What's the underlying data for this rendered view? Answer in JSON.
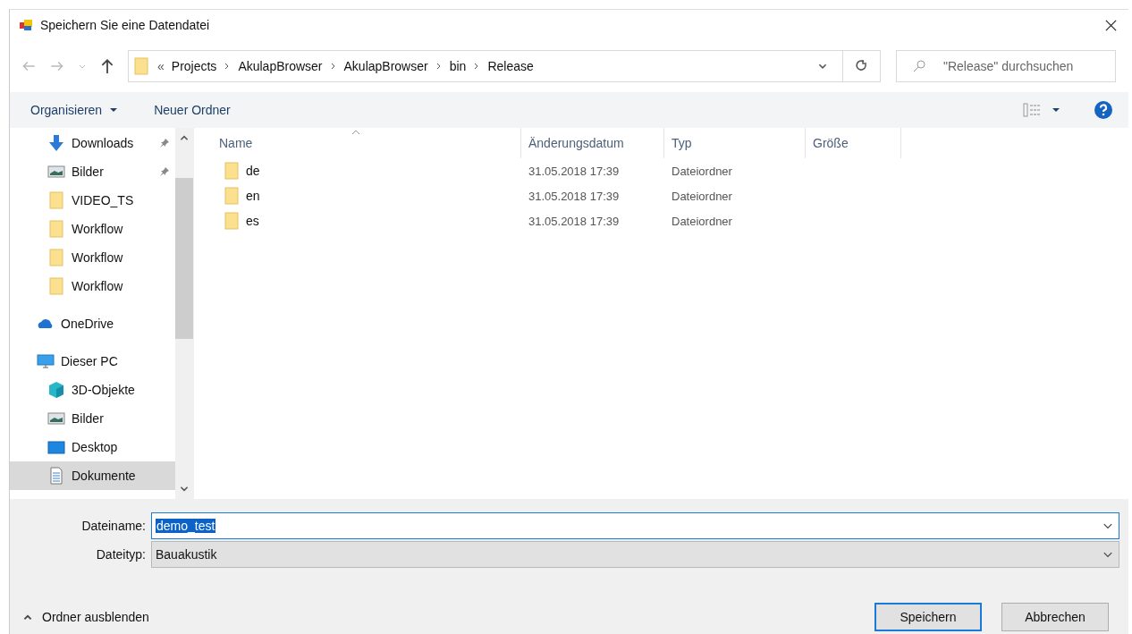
{
  "window": {
    "title": "Speichern Sie eine Datendatei"
  },
  "address_bar": {
    "overflow": "«",
    "segments": [
      "Projects",
      "AkulapBrowser",
      "AkulapBrowser",
      "bin",
      "Release"
    ]
  },
  "search": {
    "placeholder": "\"Release\" durchsuchen"
  },
  "toolbar": {
    "organize": "Organisieren",
    "new_folder": "Neuer Ordner"
  },
  "sidebar": {
    "quick_access": [
      {
        "label": "Downloads",
        "kind": "download",
        "pinned": true,
        "selected": false
      },
      {
        "label": "Bilder",
        "kind": "pictures",
        "pinned": true,
        "selected": false
      },
      {
        "label": "VIDEO_TS",
        "kind": "folder",
        "pinned": false,
        "selected": false
      },
      {
        "label": "Workflow",
        "kind": "folder",
        "pinned": false,
        "selected": false
      },
      {
        "label": "Workflow",
        "kind": "folder",
        "pinned": false,
        "selected": false
      },
      {
        "label": "Workflow",
        "kind": "folder",
        "pinned": false,
        "selected": false
      }
    ],
    "tree": [
      {
        "label": "OneDrive",
        "kind": "cloud",
        "selected": false
      },
      {
        "label": "Dieser PC",
        "kind": "pc",
        "selected": false,
        "children": [
          {
            "label": "3D-Objekte",
            "kind": "cube",
            "selected": false
          },
          {
            "label": "Bilder",
            "kind": "pictures",
            "selected": false
          },
          {
            "label": "Desktop",
            "kind": "desktop",
            "selected": false
          },
          {
            "label": "Dokumente",
            "kind": "document",
            "selected": true
          }
        ]
      }
    ]
  },
  "table": {
    "columns": [
      "Name",
      "Änderungsdatum",
      "Typ",
      "Größe"
    ],
    "rows": [
      {
        "name": "de",
        "modified": "31.05.2018 17:39",
        "type": "Dateiordner"
      },
      {
        "name": "en",
        "modified": "31.05.2018 17:39",
        "type": "Dateiordner"
      },
      {
        "name": "es",
        "modified": "31.05.2018 17:39",
        "type": "Dateiordner"
      }
    ]
  },
  "filename": {
    "label": "Dateiname:",
    "value": "demo_test"
  },
  "filetype": {
    "label": "Dateityp:",
    "value": "Bauakustik"
  },
  "hide_folders": "Ordner ausblenden",
  "buttons": [
    {
      "label": "Speichern",
      "default": true
    },
    {
      "label": "Abbrechen",
      "default": false
    }
  ]
}
